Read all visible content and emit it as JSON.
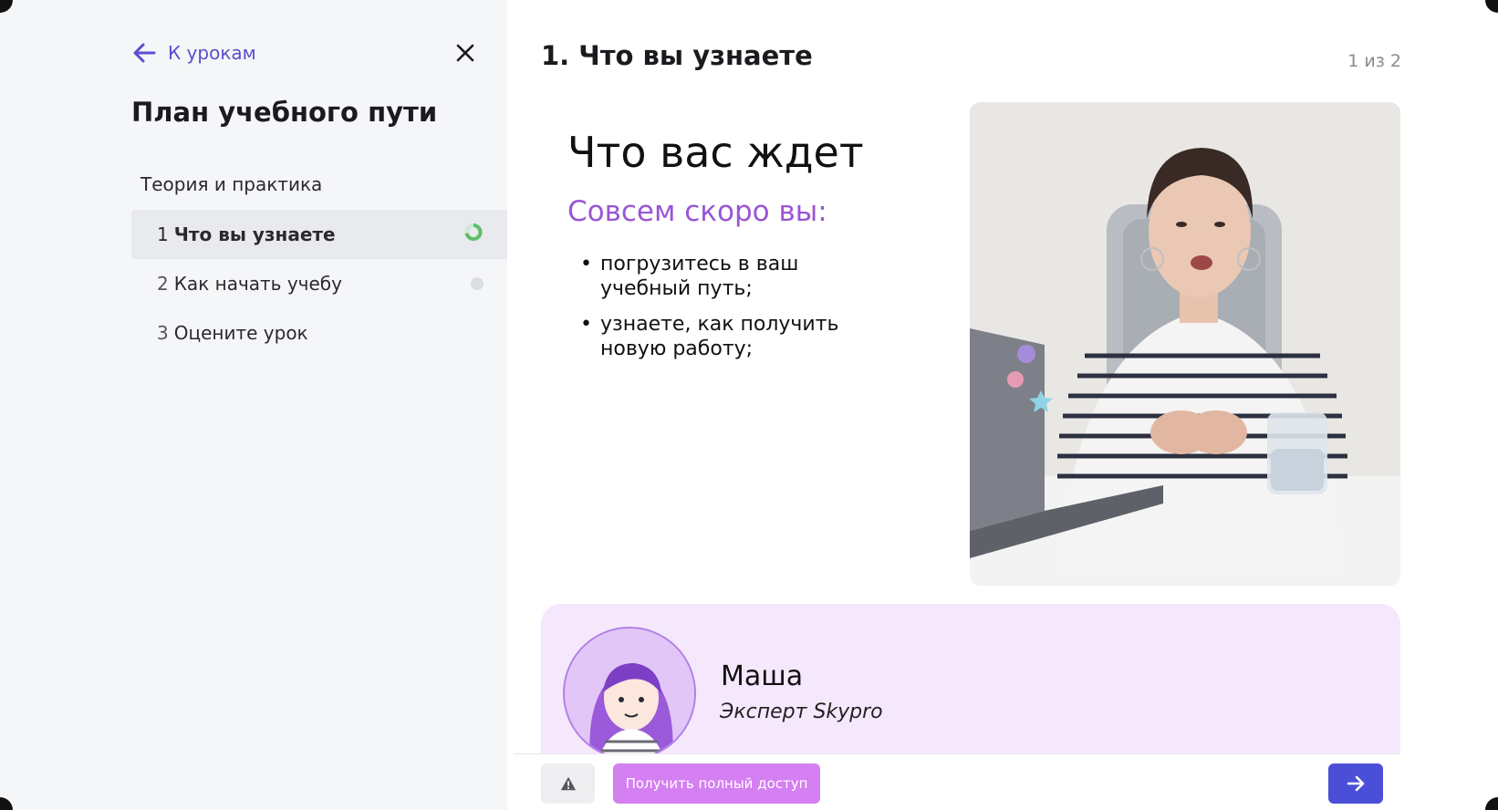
{
  "sidebar": {
    "back_label": "К урокам",
    "title": "План учебного пути",
    "section": "Теория и практика",
    "lessons": [
      {
        "num": "1",
        "label": "Что вы узнаете",
        "status": "in-progress"
      },
      {
        "num": "2",
        "label": "Как начать учебу",
        "status": "not-started"
      },
      {
        "num": "3",
        "label": "Оцените урок",
        "status": "none"
      }
    ]
  },
  "main": {
    "heading": "1. Что вы узнаете",
    "page_counter": "1 из 2",
    "slide": {
      "title": "Что вас ждет",
      "subtitle": "Совсем скоро вы:",
      "bullets": [
        "погрузитесь в ваш учебный путь;",
        "узнаете, как получить новую работу;"
      ]
    },
    "expert": {
      "name": "Маша",
      "role": "Эксперт Skypro"
    }
  },
  "bottom_bar": {
    "access_label": "Получить полный доступ"
  },
  "colors": {
    "accent": "#5a4fcf",
    "subtitle_purple": "#9a55d6",
    "access_button": "#d47ff2",
    "next_button": "#4b4fd8",
    "progress_green": "#5cbf6a",
    "expert_card_bg": "#f5e8fd"
  },
  "icons": [
    "arrow-left-icon",
    "close-icon",
    "progress-ring-icon",
    "warning-icon",
    "arrow-right-icon"
  ]
}
